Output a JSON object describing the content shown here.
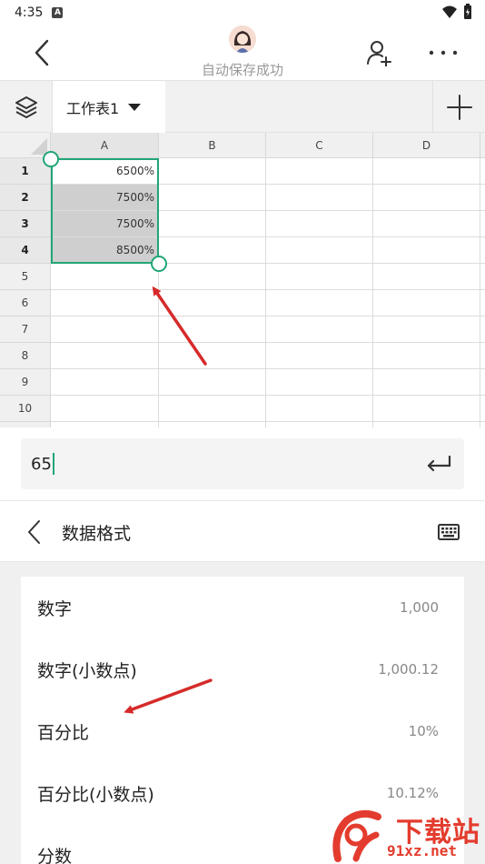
{
  "status_bar": {
    "time": "4:35",
    "notification_glyph": "A"
  },
  "toolbar": {
    "save_status": "自动保存成功"
  },
  "sheet": {
    "active_tab": "工作表1"
  },
  "grid": {
    "columns": [
      "A",
      "B",
      "C",
      "D"
    ],
    "rows": [
      "1",
      "2",
      "3",
      "4",
      "5",
      "6",
      "7",
      "8",
      "9",
      "10"
    ],
    "cells_col_a": [
      "6500%",
      "7500%",
      "7500%",
      "8500%"
    ],
    "selected_range": "A1:A4"
  },
  "formula_bar": {
    "value": "65"
  },
  "format_panel": {
    "title": "数据格式",
    "items": [
      {
        "label": "数字",
        "sample": "1,000"
      },
      {
        "label": "数字(小数点)",
        "sample": "1,000.12"
      },
      {
        "label": "百分比",
        "sample": "10%"
      },
      {
        "label": "百分比(小数点)",
        "sample": "10.12%"
      },
      {
        "label": "分数",
        "sample": ""
      }
    ]
  },
  "watermark": {
    "brand": "下载站",
    "url": "91xz.net"
  },
  "colors": {
    "accent": "#21a675",
    "annotation_arrow": "#d62a2a",
    "watermark": "#e33c2e"
  }
}
